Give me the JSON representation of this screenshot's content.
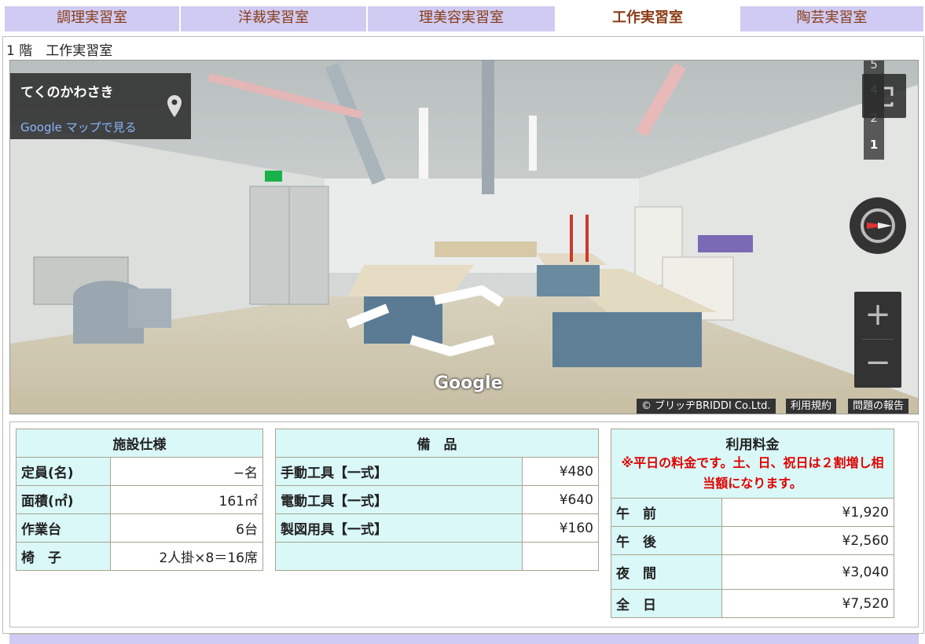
{
  "tabs": [
    {
      "label": "調理実習室",
      "active": false
    },
    {
      "label": "洋裁実習室",
      "active": false
    },
    {
      "label": "理美容実習室",
      "active": false
    },
    {
      "label": "工作実習室",
      "active": true
    },
    {
      "label": "陶芸実習室",
      "active": false
    }
  ],
  "floor_label": "1 階　工作実習室",
  "streetview": {
    "place_name": "てくのかわさき",
    "map_link": "Google マップで見る",
    "floors": [
      "5",
      "4",
      "2",
      "1"
    ],
    "current_floor": "1",
    "zoom_in": "+",
    "zoom_out": "−",
    "watermark": "Google",
    "attribution": [
      "© ブリッヂBRIDDI Co.Ltd.",
      "利用規約",
      "問題の報告"
    ],
    "icons": [
      "map-pin-icon",
      "fullscreen-icon",
      "compass-icon",
      "zoom-in-icon",
      "zoom-out-icon",
      "navigation-arrow-icon"
    ]
  },
  "specs": {
    "header": "施設仕様",
    "rows": [
      {
        "label": "定員(名)",
        "value": "−名"
      },
      {
        "label": "面積(㎡)",
        "value": "161㎡"
      },
      {
        "label": "作業台",
        "value": "6台"
      },
      {
        "label": "椅　子",
        "value": "2人掛×8＝16席"
      }
    ]
  },
  "equipment": {
    "header": "備　品",
    "rows": [
      {
        "label": "手動工具【一式】",
        "value": "¥480"
      },
      {
        "label": "電動工具【一式】",
        "value": "¥640"
      },
      {
        "label": "製図用具【一式】",
        "value": "¥160"
      },
      {
        "label": "",
        "value": ""
      }
    ]
  },
  "fees": {
    "header": "利用料金",
    "notice": "※平日の料金です。土、日、祝日は２割増し相当額になります。",
    "rows": [
      {
        "label": "午　前",
        "value": "¥1,920"
      },
      {
        "label": "午　後",
        "value": "¥2,560"
      },
      {
        "label": "夜　間",
        "value": "¥3,040"
      },
      {
        "label": "全　日",
        "value": "¥7,520"
      }
    ]
  },
  "colors": {
    "tab_bg": "#cfcbf3",
    "tab_text": "#8a3c16",
    "table_header_bg": "#d9f8f7",
    "notice_text": "#e00000"
  }
}
